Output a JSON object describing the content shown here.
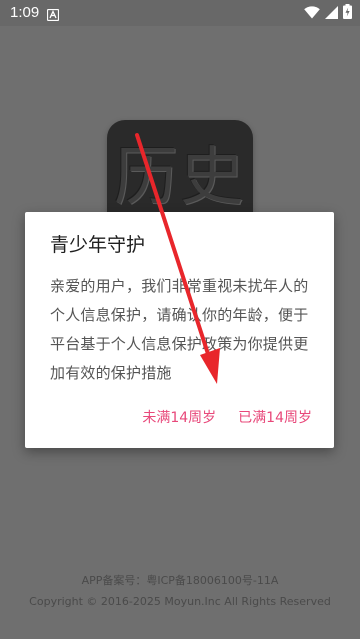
{
  "status_bar": {
    "time": "1:09",
    "icons": [
      "notification-a-icon",
      "wifi-icon",
      "signal-icon",
      "battery-icon"
    ]
  },
  "background_app": {
    "logo_text": "历史"
  },
  "dialog": {
    "title": "青少年守护",
    "message": "亲爱的用户，我们非常重视未扰年人的个人信息保护，请确认你的年龄，便于平台基于个人信息保护政策为你提供更加有效的保护措施",
    "buttons": {
      "under_14": "未满14周岁",
      "over_14": "已满14周岁"
    },
    "accent_color": "#e8487a"
  },
  "footer": {
    "icp": "APP备案号：粤ICP备18006100号-11A",
    "copyright": "Copyright © 2016-2025 Moyun.Inc All Rights Reserved"
  },
  "annotation": {
    "arrow_color": "#e8262b"
  }
}
